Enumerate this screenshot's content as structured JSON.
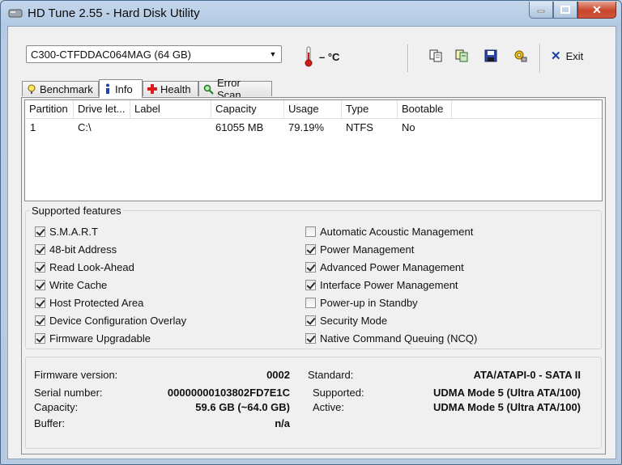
{
  "window": {
    "title": "HD Tune 2.55 - Hard Disk Utility"
  },
  "toolbar": {
    "drive": "C300-CTFDDAC064MAG (64 GB)",
    "temperature": "– °C",
    "exit_label": "Exit"
  },
  "tabs": [
    {
      "label": "Benchmark",
      "icon": "benchmark-icon"
    },
    {
      "label": "Info",
      "icon": "info-icon"
    },
    {
      "label": "Health",
      "icon": "health-icon"
    },
    {
      "label": "Error Scan",
      "icon": "error-scan-icon"
    }
  ],
  "partitions": {
    "columns": [
      "Partition",
      "Drive let...",
      "Label",
      "Capacity",
      "Usage",
      "Type",
      "Bootable"
    ],
    "rows": [
      [
        "1",
        "C:\\",
        "",
        "61055 MB",
        "79.19%",
        "NTFS",
        "No"
      ]
    ]
  },
  "features": {
    "title": "Supported features",
    "left": [
      {
        "label": "S.M.A.R.T",
        "checked": true
      },
      {
        "label": "48-bit Address",
        "checked": true
      },
      {
        "label": "Read Look-Ahead",
        "checked": true
      },
      {
        "label": "Write Cache",
        "checked": true
      },
      {
        "label": "Host Protected Area",
        "checked": true
      },
      {
        "label": "Device Configuration Overlay",
        "checked": true
      },
      {
        "label": "Firmware Upgradable",
        "checked": true
      }
    ],
    "right": [
      {
        "label": "Automatic Acoustic Management",
        "checked": false
      },
      {
        "label": "Power Management",
        "checked": true
      },
      {
        "label": "Advanced Power Management",
        "checked": true
      },
      {
        "label": "Interface Power Management",
        "checked": true
      },
      {
        "label": "Power-up in Standby",
        "checked": false
      },
      {
        "label": "Security Mode",
        "checked": true
      },
      {
        "label": "Native Command Queuing (NCQ)",
        "checked": true
      }
    ]
  },
  "info": {
    "firmware_label": "Firmware version:",
    "firmware": "0002",
    "serial_label": "Serial number:",
    "serial": "00000000103802FD7E1C",
    "capacity_label": "Capacity:",
    "capacity": "59.6 GB (~64.0 GB)",
    "buffer_label": "Buffer:",
    "buffer": "n/a",
    "standard_label": "Standard:",
    "standard": "ATA/ATAPI-0 - SATA II",
    "supported_label": "Supported:",
    "supported": "UDMA Mode 5 (Ultra ATA/100)",
    "active_label": "Active:",
    "active": "UDMA Mode 5 (Ultra ATA/100)"
  }
}
